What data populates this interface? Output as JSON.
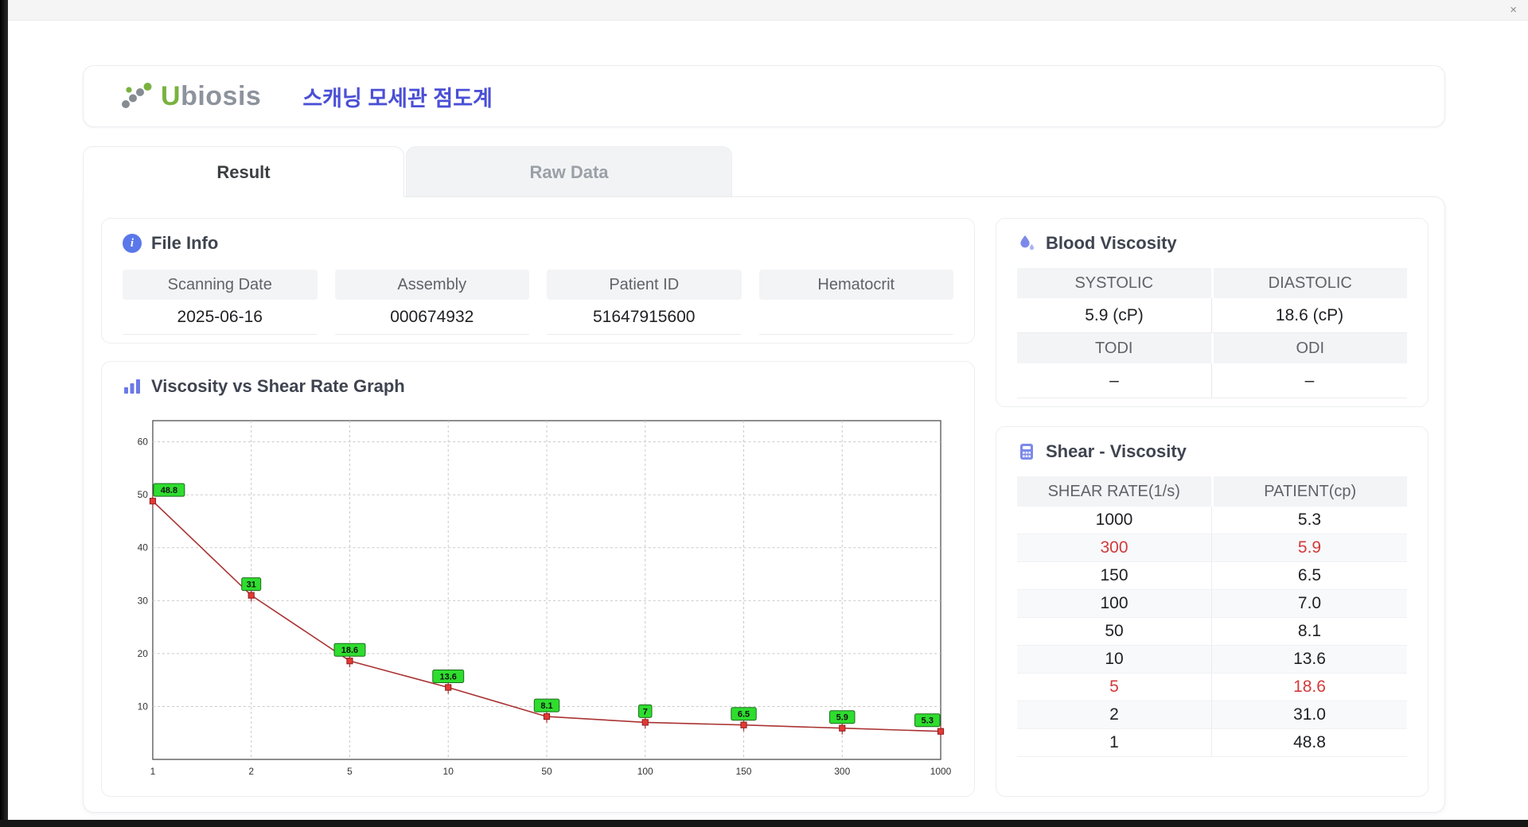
{
  "window": {
    "close": "×"
  },
  "header": {
    "logo_accent": "U",
    "logo_rest": "biosis",
    "title": "스캐닝 모세관 점도계"
  },
  "tabs": {
    "result": "Result",
    "raw_data": "Raw Data"
  },
  "file_info": {
    "title": "File Info",
    "fields": [
      {
        "label": "Scanning Date",
        "value": "2025-06-16"
      },
      {
        "label": "Assembly",
        "value": "000674932"
      },
      {
        "label": "Patient ID",
        "value": "51647915600"
      },
      {
        "label": "Hematocrit",
        "value": ""
      }
    ]
  },
  "blood_viscosity": {
    "title": "Blood Viscosity",
    "rows": [
      {
        "label": "SYSTOLIC",
        "value": "5.9 (cP)"
      },
      {
        "label": "DIASTOLIC",
        "value": "18.6 (cP)"
      },
      {
        "label": "TODI",
        "value": "–"
      },
      {
        "label": "ODI",
        "value": "–"
      }
    ]
  },
  "shear_viscosity": {
    "title": "Shear - Viscosity",
    "headers": [
      "SHEAR RATE(1/s)",
      "PATIENT(cp)"
    ],
    "rows": [
      {
        "shear": "1000",
        "patient": "5.3",
        "highlight": false
      },
      {
        "shear": "300",
        "patient": "5.9",
        "highlight": true
      },
      {
        "shear": "150",
        "patient": "6.5",
        "highlight": false
      },
      {
        "shear": "100",
        "patient": "7.0",
        "highlight": false
      },
      {
        "shear": "50",
        "patient": "8.1",
        "highlight": false
      },
      {
        "shear": "10",
        "patient": "13.6",
        "highlight": false
      },
      {
        "shear": "5",
        "patient": "18.6",
        "highlight": true
      },
      {
        "shear": "2",
        "patient": "31.0",
        "highlight": false
      },
      {
        "shear": "1",
        "patient": "48.8",
        "highlight": false
      }
    ]
  },
  "chart_data": {
    "type": "line",
    "title": "Viscosity vs Shear Rate Graph",
    "x": [
      1,
      2,
      5,
      10,
      50,
      100,
      150,
      300,
      1000
    ],
    "values": [
      48.8,
      31,
      18.6,
      13.6,
      8.1,
      7,
      6.5,
      5.9,
      5.3
    ],
    "point_labels": [
      "48.8",
      "31",
      "18.6",
      "13.6",
      "8.1",
      "7",
      "6.5",
      "5.9",
      "5.3"
    ],
    "xlabel": "",
    "ylabel": "",
    "ylim": [
      0,
      64
    ],
    "yticks": [
      10,
      20,
      30,
      40,
      50,
      60
    ],
    "grid": true,
    "line_color": "#aa3333",
    "marker_color": "#e53935",
    "label_bg": "#2edd2e"
  }
}
